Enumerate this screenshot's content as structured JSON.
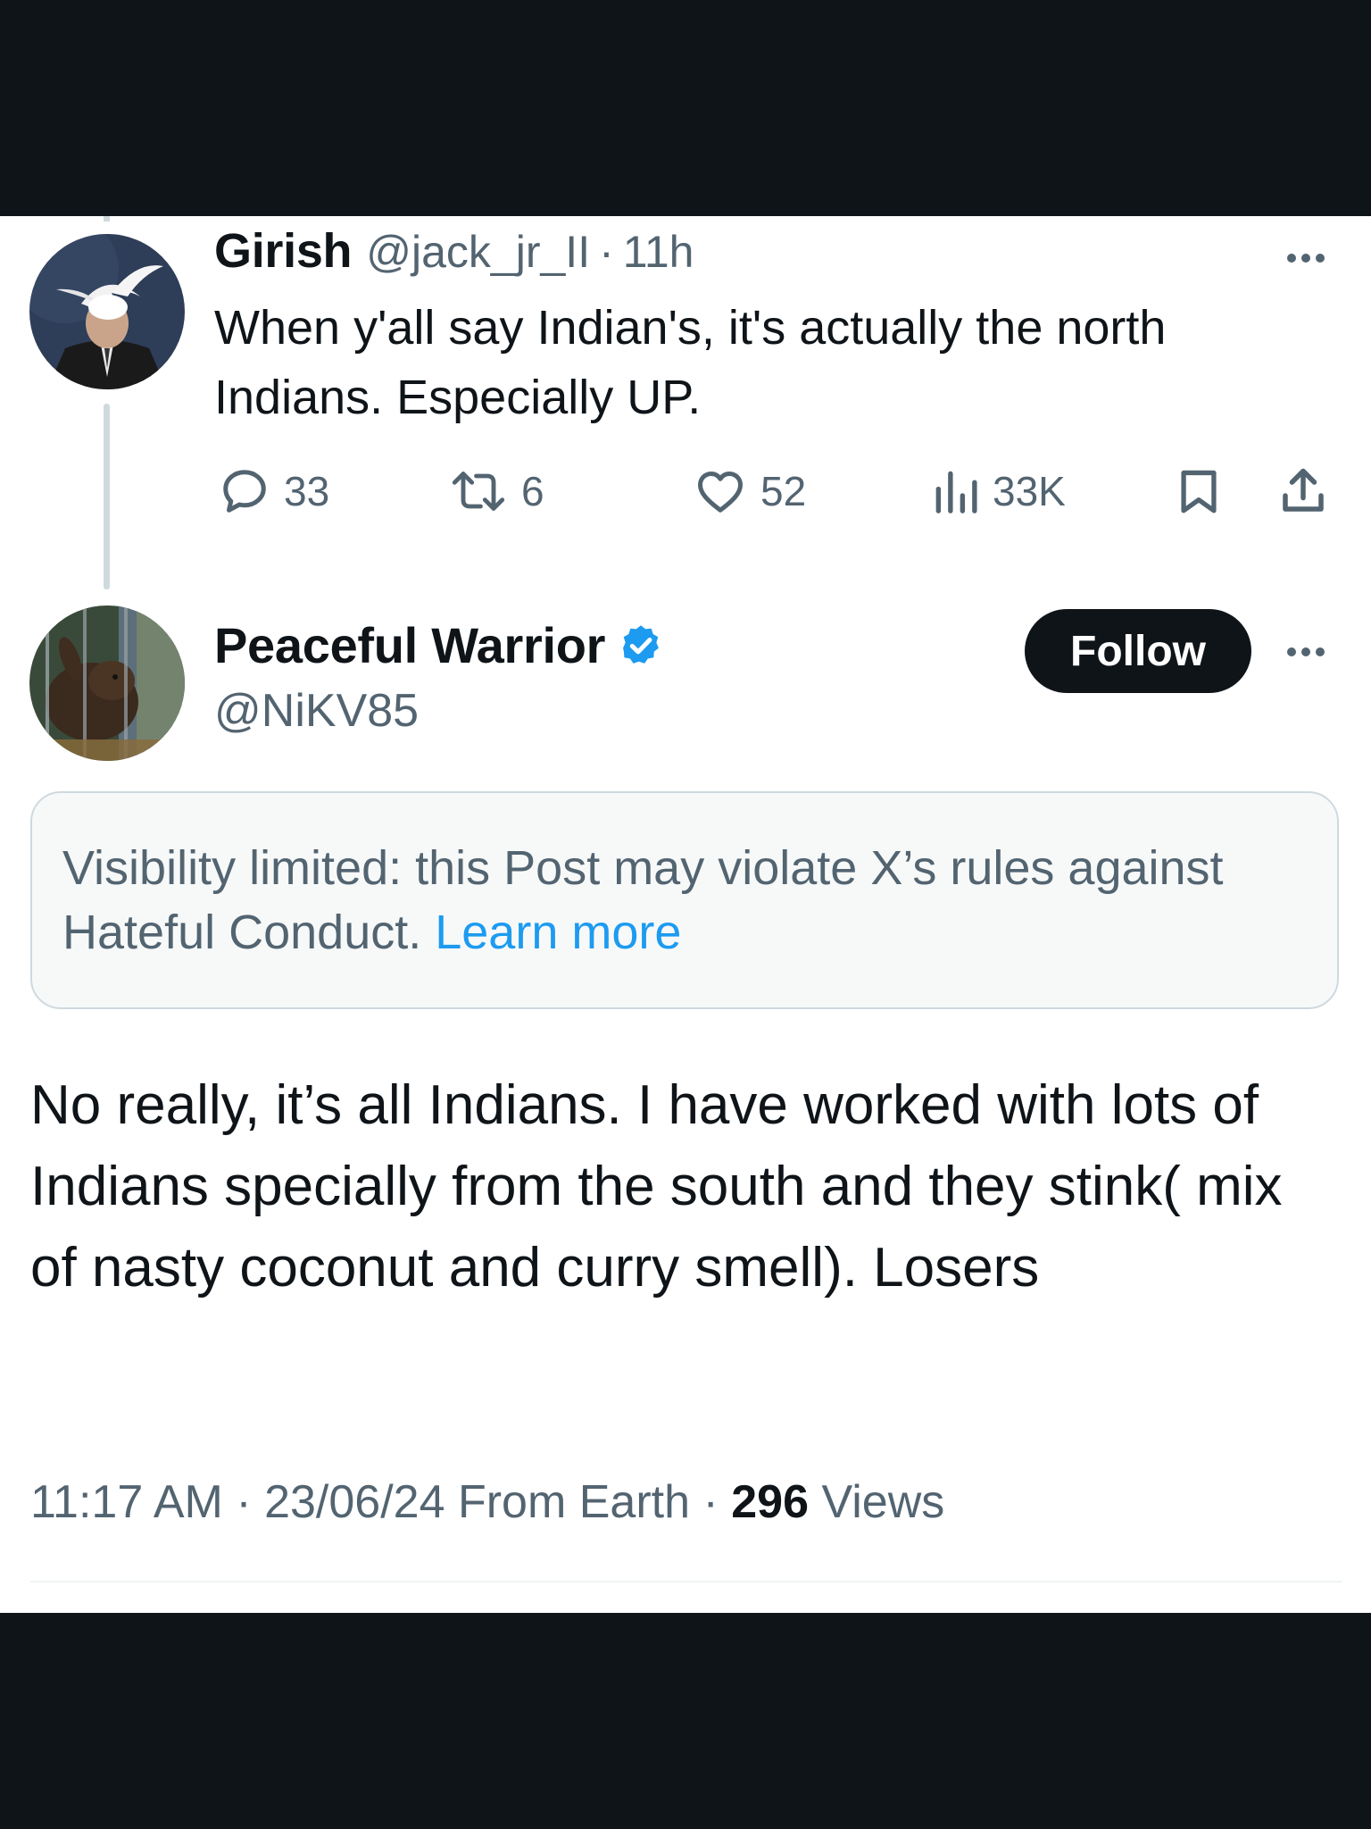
{
  "parent_post": {
    "author_name": "Girish",
    "handle": "@jack_jr_II",
    "separator": "·",
    "time": "11h",
    "text": "When y'all say Indian's, it's actually the north Indians. Especially UP.",
    "counts": {
      "replies": "33",
      "reposts": "6",
      "likes": "52",
      "views": "33K"
    },
    "icons": [
      "reply-icon",
      "repost-icon",
      "like-icon",
      "views-icon",
      "bookmark-icon",
      "share-icon"
    ]
  },
  "reply_post": {
    "author_name": "Peaceful Warrior",
    "handle": "@NiKV85",
    "follow_label": "Follow",
    "notice_text": "Visibility limited: this Post may violate X’s rules against Hateful Conduct. ",
    "notice_link": "Learn more",
    "text": "No really, it’s all Indians. I have worked with lots of Indians specially from the south and they stink( mix of nasty coconut and curry smell). Losers",
    "time": "11:17 AM",
    "dot": "·",
    "date": "23/06/24",
    "source": "From Earth",
    "views_count": "296",
    "views_label": "Views"
  },
  "colors": {
    "text": "#0f1419",
    "secondary": "#536471",
    "link": "#1d9bf0",
    "notice_bg": "#f7f9f9",
    "border": "#cfd9de",
    "background_frame": "#0f1419"
  }
}
